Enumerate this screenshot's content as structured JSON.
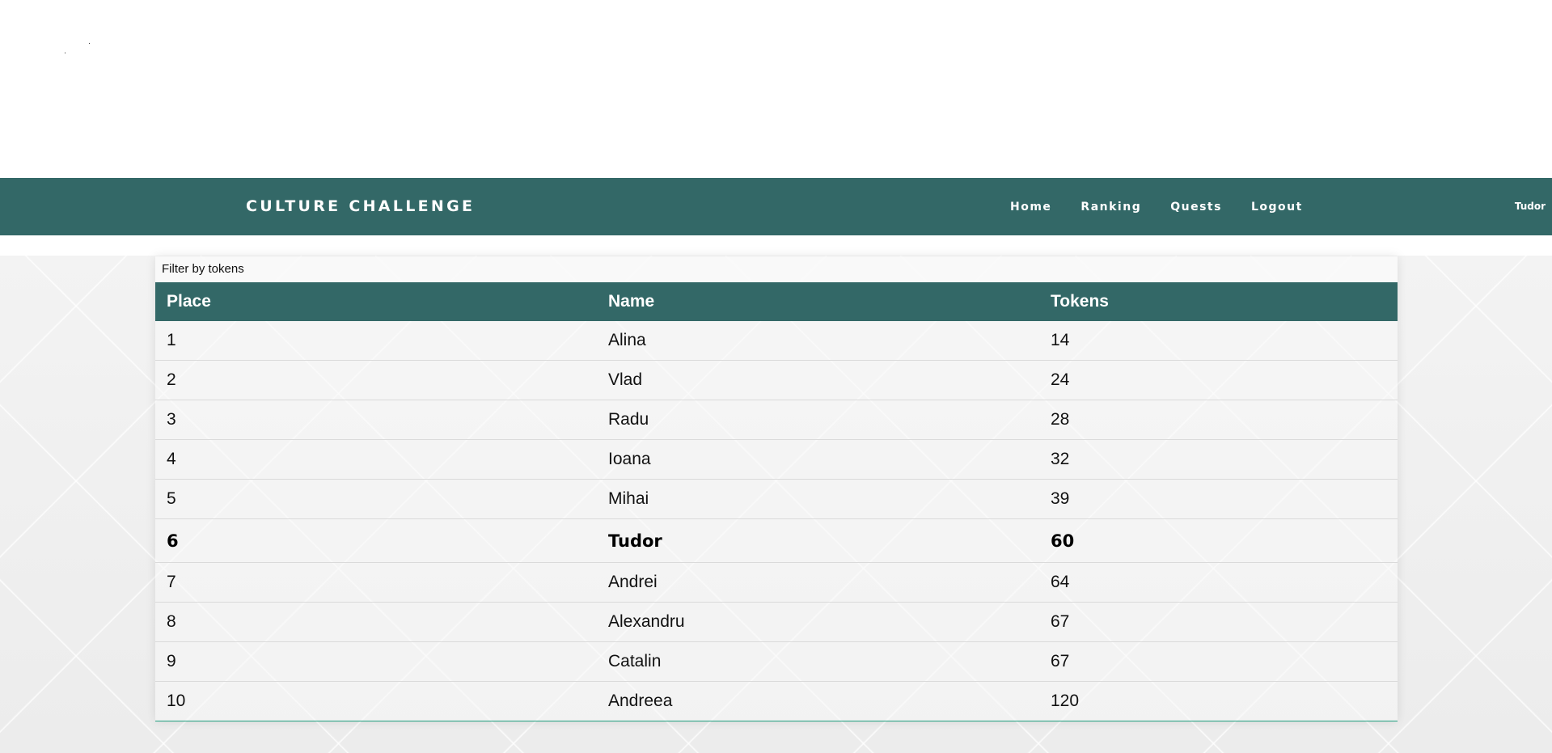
{
  "app": {
    "brand": "CULTURE CHALLENGE",
    "current_user": "Tudor"
  },
  "nav": {
    "items": [
      {
        "label": "Home"
      },
      {
        "label": "Ranking"
      },
      {
        "label": "Quests"
      },
      {
        "label": "Logout"
      }
    ]
  },
  "filter": {
    "label": "Filter by tokens"
  },
  "table": {
    "headers": [
      "Place",
      "Name",
      "Tokens"
    ],
    "rows": [
      {
        "place": "1",
        "name": "Alina",
        "tokens": "14"
      },
      {
        "place": "2",
        "name": "Vlad",
        "tokens": "24"
      },
      {
        "place": "3",
        "name": "Radu",
        "tokens": "28"
      },
      {
        "place": "4",
        "name": "Ioana",
        "tokens": "32"
      },
      {
        "place": "5",
        "name": "Mihai",
        "tokens": "39"
      },
      {
        "place": "6",
        "name": "Tudor",
        "tokens": "60",
        "highlighted": true
      },
      {
        "place": "7",
        "name": "Andrei",
        "tokens": "64"
      },
      {
        "place": "8",
        "name": "Alexandru",
        "tokens": "67"
      },
      {
        "place": "9",
        "name": "Catalin",
        "tokens": "67"
      },
      {
        "place": "10",
        "name": "Andreea",
        "tokens": "120"
      }
    ]
  },
  "colors": {
    "primary": "#336867",
    "accent_line": "#1f9f7f"
  }
}
